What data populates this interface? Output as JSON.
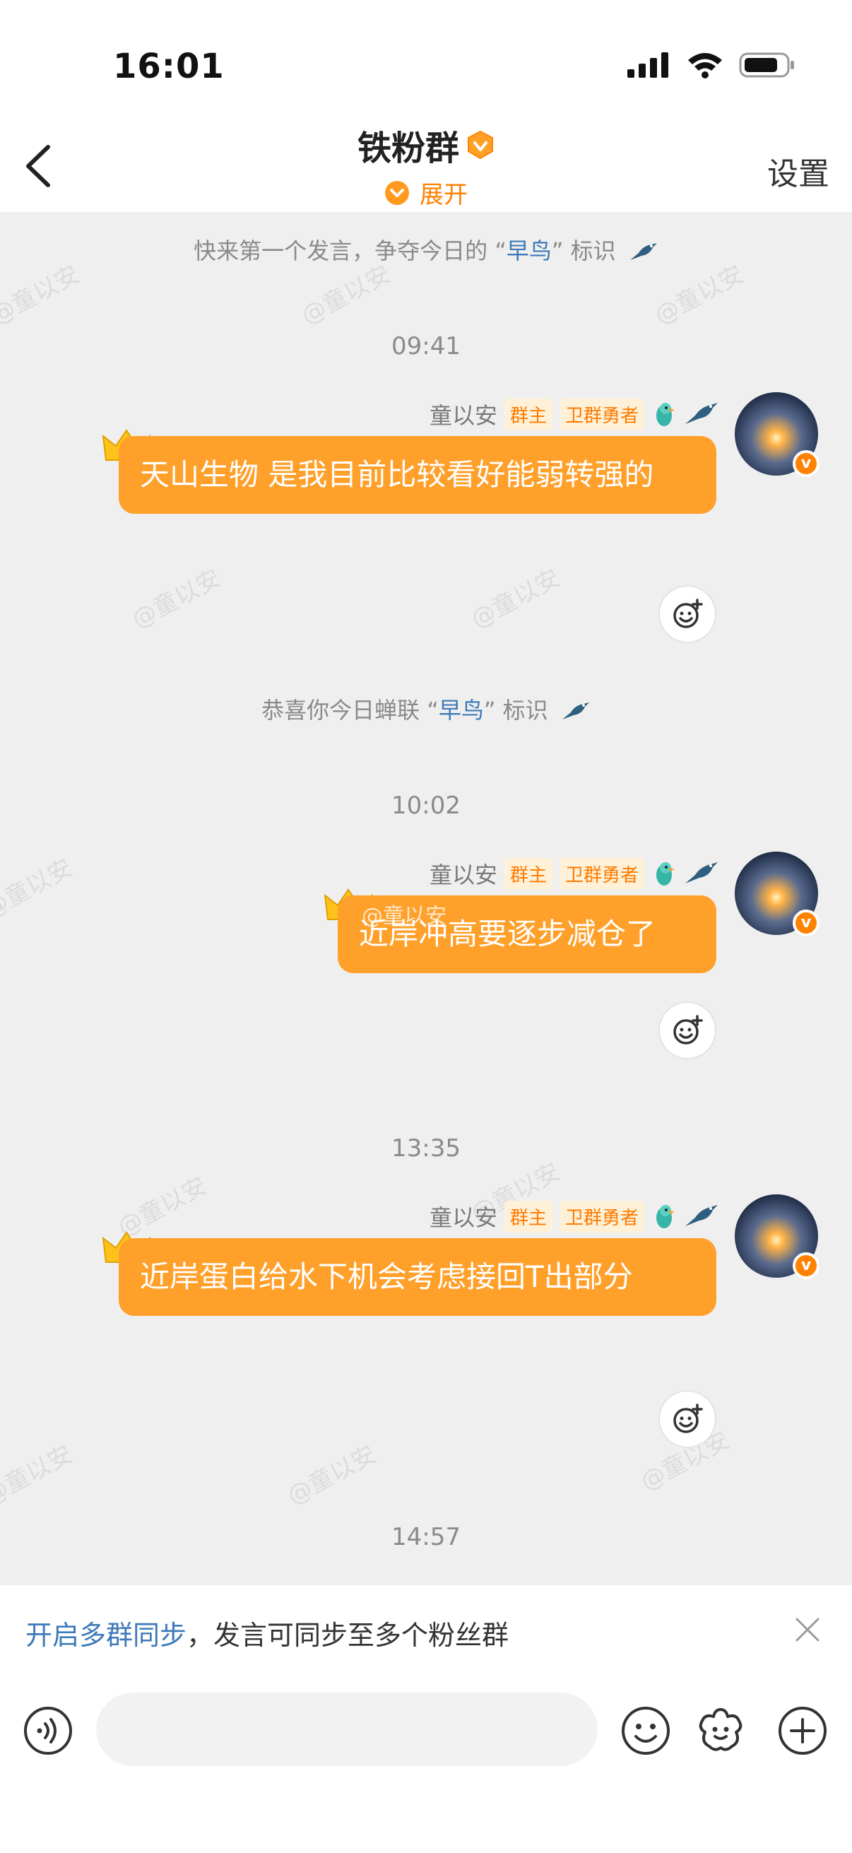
{
  "status_bar": {
    "time": "16:01"
  },
  "header": {
    "title": "铁粉群",
    "expand_label": "展开",
    "settings_label": "设置"
  },
  "watermark_text": "@童以安",
  "system_messages": [
    {
      "pre": "快来第一个发言，争夺今日的 “",
      "highlight": "早鸟",
      "post": "” 标识"
    },
    {
      "pre": "恭喜你今日蝉联 “",
      "highlight": "早鸟",
      "post": "” 标识"
    }
  ],
  "timestamps": [
    "09:41",
    "10:02",
    "13:35",
    "14:57"
  ],
  "sender": {
    "name": "童以安",
    "badge_owner": "群主",
    "badge_role": "卫群勇者"
  },
  "messages": [
    {
      "text": "天山生物 是我目前比较看好能弱转强的"
    },
    {
      "text": "近岸冲高要逐步减仓了",
      "overlay": "@童以安"
    },
    {
      "text": "近岸蛋白给水下机会考虑接回T出部分"
    }
  ],
  "notice": {
    "link": "开启多群同步",
    "text": "，发言可同步至多个粉丝群"
  },
  "input": {
    "placeholder": ""
  },
  "colors": {
    "accent": "#ff8200",
    "bubble": "#ffa02b",
    "link": "#3d7ab8"
  }
}
